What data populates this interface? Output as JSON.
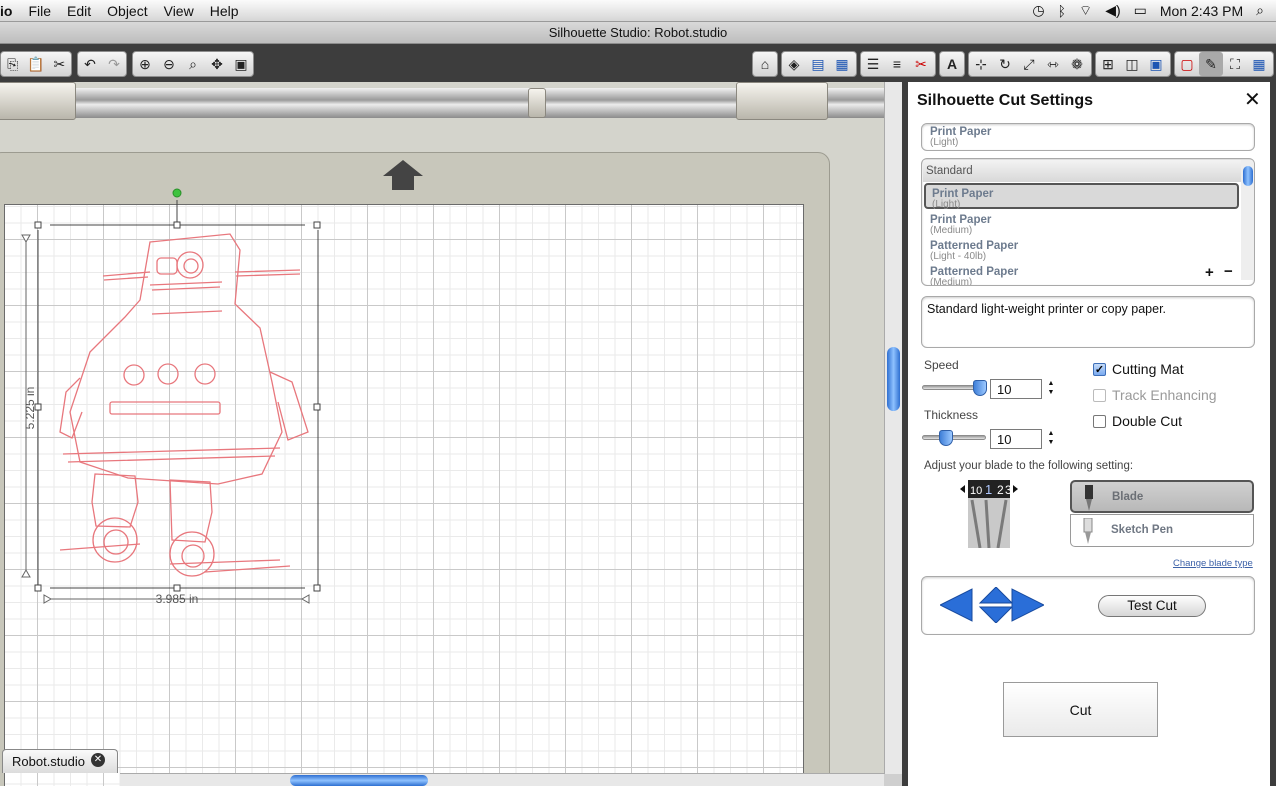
{
  "menubar": {
    "app": "io",
    "items": [
      "File",
      "Edit",
      "Object",
      "View",
      "Help"
    ],
    "clock": "Mon 2:43 PM"
  },
  "window": {
    "title": "Silhouette Studio: Robot.studio"
  },
  "design": {
    "height_label": "5.225 in",
    "width_label": "3.985 in",
    "tab_label": "Robot.studio"
  },
  "panel": {
    "title": "Silhouette Cut Settings",
    "current_material": {
      "name": "Print Paper",
      "sub": "(Light)"
    },
    "list_header": "Standard",
    "materials": [
      {
        "name": "Print Paper",
        "sub": "(Light)",
        "selected": true
      },
      {
        "name": "Print Paper",
        "sub": "(Medium)",
        "selected": false
      },
      {
        "name": "Patterned Paper",
        "sub": "(Light - 40lb)",
        "selected": false
      },
      {
        "name": "Patterned Paper",
        "sub": "(Medium)",
        "selected": false
      }
    ],
    "description": "Standard light-weight printer or copy paper.",
    "speed_label": "Speed",
    "speed_value": "10",
    "thickness_label": "Thickness",
    "thickness_value": "10",
    "cutting_mat_label": "Cutting Mat",
    "track_enhancing_label": "Track Enhancing",
    "double_cut_label": "Double Cut",
    "blade_instruction": "Adjust your blade to the following setting:",
    "blade_dial": [
      "10",
      "1",
      "2",
      "3"
    ],
    "tool_blade": "Blade",
    "tool_sketch": "Sketch Pen",
    "change_blade": "Change blade type",
    "test_cut": "Test Cut",
    "cut": "Cut"
  }
}
